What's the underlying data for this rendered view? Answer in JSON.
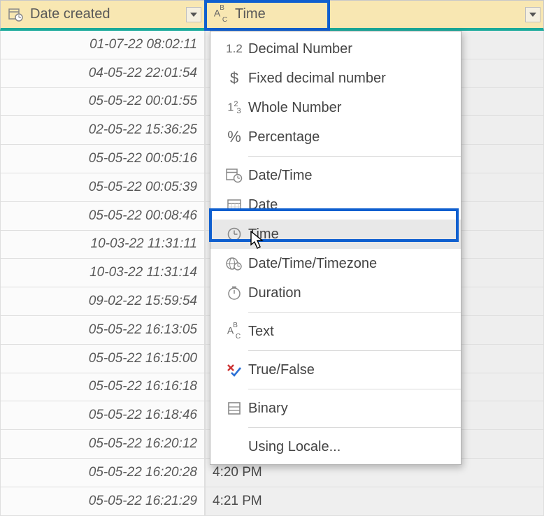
{
  "columns": {
    "date_created": {
      "label": "Date created",
      "type_icon": "datetime"
    },
    "time": {
      "label": "Time",
      "type_icon": "abc"
    }
  },
  "rows": [
    {
      "date": "01-07-22 08:02:11",
      "time": ""
    },
    {
      "date": "04-05-22 22:01:54",
      "time": ""
    },
    {
      "date": "05-05-22 00:01:55",
      "time": ""
    },
    {
      "date": "02-05-22 15:36:25",
      "time": ""
    },
    {
      "date": "05-05-22 00:05:16",
      "time": ""
    },
    {
      "date": "05-05-22 00:05:39",
      "time": ""
    },
    {
      "date": "05-05-22 00:08:46",
      "time": ""
    },
    {
      "date": "10-03-22 11:31:11",
      "time": ""
    },
    {
      "date": "10-03-22 11:31:14",
      "time": ""
    },
    {
      "date": "09-02-22 15:59:54",
      "time": ""
    },
    {
      "date": "05-05-22 16:13:05",
      "time": ""
    },
    {
      "date": "05-05-22 16:15:00",
      "time": ""
    },
    {
      "date": "05-05-22 16:16:18",
      "time": ""
    },
    {
      "date": "05-05-22 16:18:46",
      "time": ""
    },
    {
      "date": "05-05-22 16:20:12",
      "time": ""
    },
    {
      "date": "05-05-22 16:20:28",
      "time": "4:20 PM"
    },
    {
      "date": "05-05-22 16:21:29",
      "time": "4:21 PM"
    }
  ],
  "type_menu": {
    "items": [
      {
        "icon": "1.2",
        "label": "Decimal Number"
      },
      {
        "icon": "$",
        "label": "Fixed decimal number"
      },
      {
        "icon": "123",
        "label": "Whole Number"
      },
      {
        "icon": "%",
        "label": "Percentage"
      },
      {
        "separator": true
      },
      {
        "icon": "datetime",
        "label": "Date/Time"
      },
      {
        "icon": "date",
        "label": "Date"
      },
      {
        "icon": "time",
        "label": "Time",
        "hover": true
      },
      {
        "icon": "tz",
        "label": "Date/Time/Timezone"
      },
      {
        "icon": "dur",
        "label": "Duration"
      },
      {
        "separator": true
      },
      {
        "icon": "abc",
        "label": "Text"
      },
      {
        "separator": true
      },
      {
        "icon": "tf",
        "label": "True/False"
      },
      {
        "separator": true
      },
      {
        "icon": "bin",
        "label": "Binary"
      },
      {
        "separator": true
      },
      {
        "icon": "",
        "label": "Using Locale..."
      }
    ]
  }
}
